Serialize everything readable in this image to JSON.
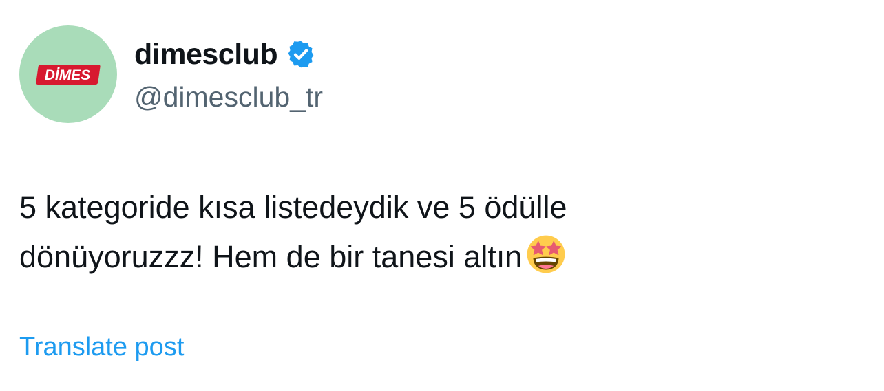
{
  "post": {
    "author": {
      "display_name": "dimesclub",
      "handle": "@dimesclub_tr",
      "verified": true,
      "avatar": {
        "logo_text": "DİMES",
        "background_color": "#a9dcb9",
        "logo_color": "#d7192f"
      }
    },
    "text_lines": [
      "5 kategoride kısa listedeydik ve 5 ödülle",
      "dönüyoruzzz! Hem de bir tanesi altın"
    ],
    "emoji": "star-struck-emoji",
    "translate_label": "Translate post",
    "link_color": "#1d9bf0",
    "verified_color": "#1d9bf0"
  }
}
